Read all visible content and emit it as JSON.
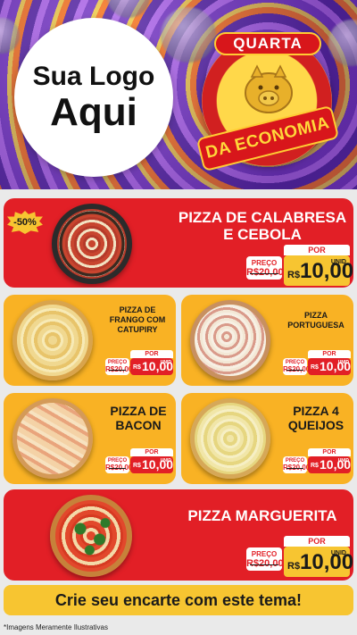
{
  "header": {
    "logo_line1": "Sua Logo",
    "logo_line2": "Aqui",
    "badge_top": "QUARTA",
    "badge_bottom": "DA ECONOMIA",
    "piggy_icon": "piggy-bank-icon"
  },
  "colors": {
    "red": "#e21f26",
    "yellow": "#f9b224",
    "price_yellow": "#f7c531"
  },
  "items": [
    {
      "name_line1": "PIZZA DE CALABRESA",
      "name_line2": "E CEBOLA",
      "discount": "-50%",
      "por": "POR",
      "old_label": "PREÇO",
      "old_value": "R$20,00",
      "currency": "R$",
      "price": "10,00",
      "unit": "UNID"
    },
    {
      "name_line1": "PIZZA DE",
      "name_line2": "FRANGO COM",
      "name_line3": "CATUPIRY",
      "por": "POR",
      "old_label": "PREÇO",
      "old_value": "R$20,00",
      "currency": "R$",
      "price": "10,00",
      "unit": "UNID"
    },
    {
      "name_line1": "PIZZA",
      "name_line2": "PORTUGUESA",
      "por": "POR",
      "old_label": "PREÇO",
      "old_value": "R$20,00",
      "currency": "R$",
      "price": "10,00",
      "unit": "UNID"
    },
    {
      "name_line1": "PIZZA DE",
      "name_line2": "BACON",
      "por": "POR",
      "old_label": "PREÇO",
      "old_value": "R$20,00",
      "currency": "R$",
      "price": "10,00",
      "unit": "UNID"
    },
    {
      "name_line1": "PIZZA 4",
      "name_line2": "QUEIJOS",
      "por": "POR",
      "old_label": "PREÇO",
      "old_value": "R$20,00",
      "currency": "R$",
      "price": "10,00",
      "unit": "UNID"
    },
    {
      "name_line1": "PIZZA MARGUERITA",
      "por": "POR",
      "old_label": "PREÇO",
      "old_value": "R$20,00",
      "currency": "R$",
      "price": "10,00",
      "unit": "UNID"
    }
  ],
  "banner": "Crie seu encarte com este tema!",
  "footer_note": "*Imagens Meramente Ilustrativas"
}
